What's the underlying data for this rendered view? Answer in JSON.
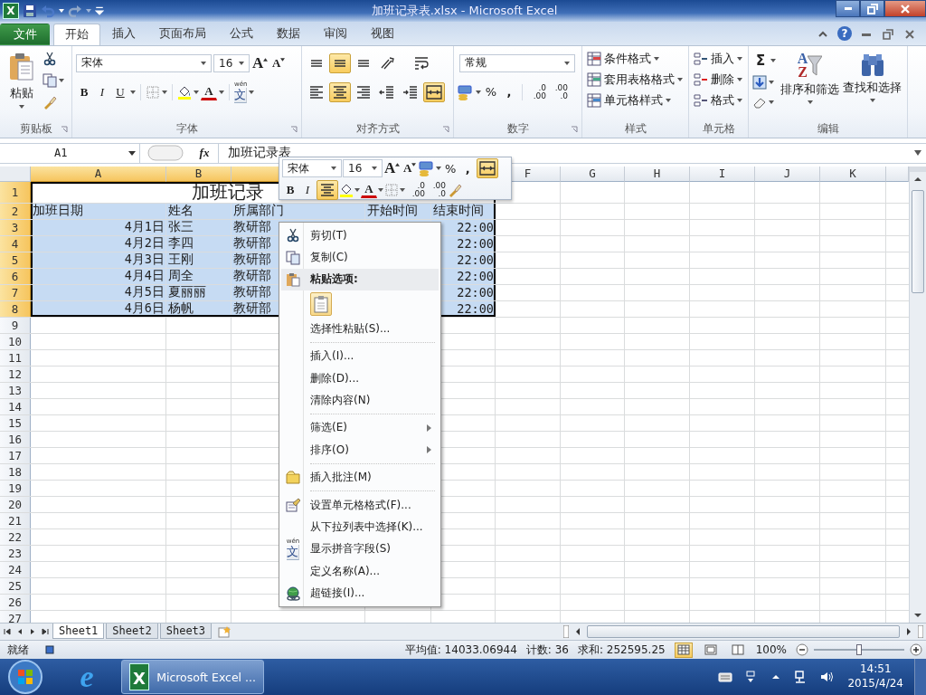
{
  "window": {
    "app_logo": "X",
    "title": "加班记录表.xlsx - Microsoft Excel",
    "help": "?"
  },
  "ribbon_tabs": [
    {
      "label": "文件",
      "kind": "file",
      "selected": false
    },
    {
      "label": "开始",
      "kind": "tab",
      "selected": true
    },
    {
      "label": "插入",
      "kind": "tab",
      "selected": false
    },
    {
      "label": "页面布局",
      "kind": "tab",
      "selected": false
    },
    {
      "label": "公式",
      "kind": "tab",
      "selected": false
    },
    {
      "label": "数据",
      "kind": "tab",
      "selected": false
    },
    {
      "label": "审阅",
      "kind": "tab",
      "selected": false
    },
    {
      "label": "视图",
      "kind": "tab",
      "selected": false
    }
  ],
  "ribbon": {
    "clipboard": {
      "label": "剪贴板",
      "paste": "粘贴"
    },
    "font": {
      "label": "字体",
      "font_name": "宋体",
      "font_size": "16",
      "grow_font": "A",
      "shrink_font": "A",
      "bold": "B",
      "italic": "I",
      "underline": "U",
      "font_color": "A",
      "phonetic_pinyin": "wén",
      "phonetic_char": "文"
    },
    "alignment": {
      "label": "对齐方式",
      "buttons": [
        {
          "kind": "top",
          "selected": false
        },
        {
          "kind": "middle",
          "selected": true
        },
        {
          "kind": "bottom",
          "selected": false
        },
        {
          "kind": "orientation",
          "selected": false
        },
        {
          "kind": "wrap",
          "selected": false
        },
        {
          "kind": "left",
          "selected": false
        },
        {
          "kind": "center",
          "selected": true
        },
        {
          "kind": "right",
          "selected": false
        },
        {
          "kind": "outdent",
          "selected": false
        },
        {
          "kind": "indent",
          "selected": false
        },
        {
          "kind": "merge",
          "selected": true
        }
      ]
    },
    "number": {
      "label": "数字",
      "format": "常规",
      "percent": "%",
      "comma": ",",
      "increase_decimal": [
        ".0",
        ".00"
      ],
      "decrease_decimal": [
        ".00",
        ".0"
      ]
    },
    "styles": {
      "label": "样式",
      "items": [
        "条件格式",
        "套用表格格式",
        "单元格样式"
      ]
    },
    "cells": {
      "label": "单元格",
      "items": [
        "插入",
        "删除",
        "格式"
      ]
    },
    "editing": {
      "label": "编辑",
      "sum": "Σ",
      "sort_letters": [
        "A",
        "Z"
      ],
      "sort": "排序和筛选",
      "find": "查找和选择"
    }
  },
  "formula_bar": {
    "name_box": "A1",
    "fx": "fx",
    "content": "加班记录表"
  },
  "sheet": {
    "columns": [
      {
        "label": "A",
        "selected": true
      },
      {
        "label": "B",
        "selected": true
      },
      {
        "selected": true
      },
      {
        "selected": true
      },
      {
        "selected": true
      },
      {
        "label": "F",
        "selected": false
      },
      {
        "label": "G",
        "selected": false
      },
      {
        "label": "H",
        "selected": false
      },
      {
        "label": "I",
        "selected": false
      },
      {
        "label": "J",
        "selected": false
      },
      {
        "label": "K",
        "selected": false
      }
    ],
    "rows": [
      {
        "label": "1",
        "selected": true
      },
      {
        "label": "2",
        "selected": true
      },
      {
        "label": "3",
        "selected": true
      },
      {
        "label": "4",
        "selected": true
      },
      {
        "label": "5",
        "selected": true
      },
      {
        "label": "6",
        "selected": true
      },
      {
        "label": "7",
        "selected": true
      },
      {
        "label": "8",
        "selected": true
      },
      {
        "label": "9",
        "selected": false
      },
      {
        "label": "10",
        "selected": false
      },
      {
        "label": "11",
        "selected": false
      },
      {
        "label": "12",
        "selected": false
      },
      {
        "label": "13",
        "selected": false
      },
      {
        "label": "14",
        "selected": false
      },
      {
        "label": "15",
        "selected": false
      },
      {
        "label": "16",
        "selected": false
      },
      {
        "label": "17",
        "selected": false
      },
      {
        "label": "18",
        "selected": false
      },
      {
        "label": "19",
        "selected": false
      },
      {
        "label": "20",
        "selected": false
      },
      {
        "label": "21",
        "selected": false
      },
      {
        "label": "22",
        "selected": false
      },
      {
        "label": "23",
        "selected": false
      },
      {
        "label": "24",
        "selected": false
      },
      {
        "label": "25",
        "selected": false
      },
      {
        "label": "26",
        "selected": false
      },
      {
        "label": "27",
        "selected": false
      }
    ],
    "title_cell": "加班记录",
    "header_cells": [
      "加班日期",
      "姓名",
      "所属部门",
      "开始时间",
      "结束时间"
    ],
    "data_rows": [
      {
        "date": "4月1日",
        "name": "张三",
        "department": "教研部",
        "end_time": "22:00"
      },
      {
        "date": "4月2日",
        "name": "李四",
        "department": "教研部",
        "end_time": "22:00"
      },
      {
        "date": "4月3日",
        "name": "王刚",
        "department": "教研部",
        "end_time": "22:00"
      },
      {
        "date": "4月4日",
        "name": "周全",
        "department": "教研部",
        "end_time": "22:00"
      },
      {
        "date": "4月5日",
        "name": "夏丽丽",
        "department": "教研部",
        "end_time": "22:00"
      },
      {
        "date": "4月6日",
        "name": "杨帆",
        "department": "教研部",
        "end_time": "22:00"
      }
    ]
  },
  "mini_toolbar": {
    "font_name": "宋体",
    "font_size": "16",
    "grow_font": "A",
    "shrink_font": "A",
    "percent": "%",
    "comma": ",",
    "merge_selected": true,
    "bold": "B",
    "italic": "I",
    "center_selected": true,
    "font_color": "A",
    "increase_decimal": [
      ".0",
      ".00"
    ],
    "decrease_decimal": [
      ".00",
      ".0"
    ]
  },
  "context_menu": [
    {
      "kind": "cut",
      "label": "剪切(T)",
      "submenu": false
    },
    {
      "kind": "copy",
      "label": "复制(C)",
      "submenu": false
    },
    {
      "kind": "paste_header",
      "label": "粘贴选项:"
    },
    {
      "kind": "paste_options"
    },
    {
      "kind": "item",
      "label": "选择性粘贴(S)...",
      "submenu": false
    },
    {
      "kind": "separator"
    },
    {
      "kind": "item",
      "label": "插入(I)...",
      "submenu": false
    },
    {
      "kind": "item",
      "label": "删除(D)...",
      "submenu": false
    },
    {
      "kind": "item",
      "label": "清除内容(N)",
      "submenu": false
    },
    {
      "kind": "separator"
    },
    {
      "kind": "item",
      "label": "筛选(E)",
      "submenu": true
    },
    {
      "kind": "item",
      "label": "排序(O)",
      "submenu": true
    },
    {
      "kind": "separator"
    },
    {
      "kind": "note",
      "label": "插入批注(M)",
      "submenu": false
    },
    {
      "kind": "separator"
    },
    {
      "kind": "format",
      "label": "设置单元格格式(F)...",
      "submenu": false
    },
    {
      "kind": "item",
      "label": "从下拉列表中选择(K)...",
      "submenu": false
    },
    {
      "kind": "phonetic",
      "label": "显示拼音字段(S)",
      "icon_pinyin": "wén",
      "icon_char": "文",
      "submenu": false
    },
    {
      "kind": "item",
      "label": "定义名称(A)...",
      "submenu": false
    },
    {
      "kind": "link",
      "label": "超链接(I)...",
      "submenu": false
    }
  ],
  "sheet_tabs": [
    {
      "label": "Sheet1",
      "selected": true
    },
    {
      "label": "Sheet2",
      "selected": false
    },
    {
      "label": "Sheet3",
      "selected": false
    }
  ],
  "status_bar": {
    "ready": "就绪",
    "average": "平均值: 14033.06944",
    "count": "计数: 36",
    "sum": "求和: 252595.25",
    "views": [
      {
        "kind": "normal",
        "selected": true
      },
      {
        "kind": "layout",
        "selected": false
      },
      {
        "kind": "page_break",
        "selected": false
      }
    ],
    "zoom": "100%",
    "zoom_slider": {
      "level": 0.5
    }
  },
  "taskbar": {
    "browser_logo": "e",
    "task_logo": "X",
    "task_label": "Microsoft Excel ...",
    "time": "14:51",
    "date": "2015/4/24"
  }
}
